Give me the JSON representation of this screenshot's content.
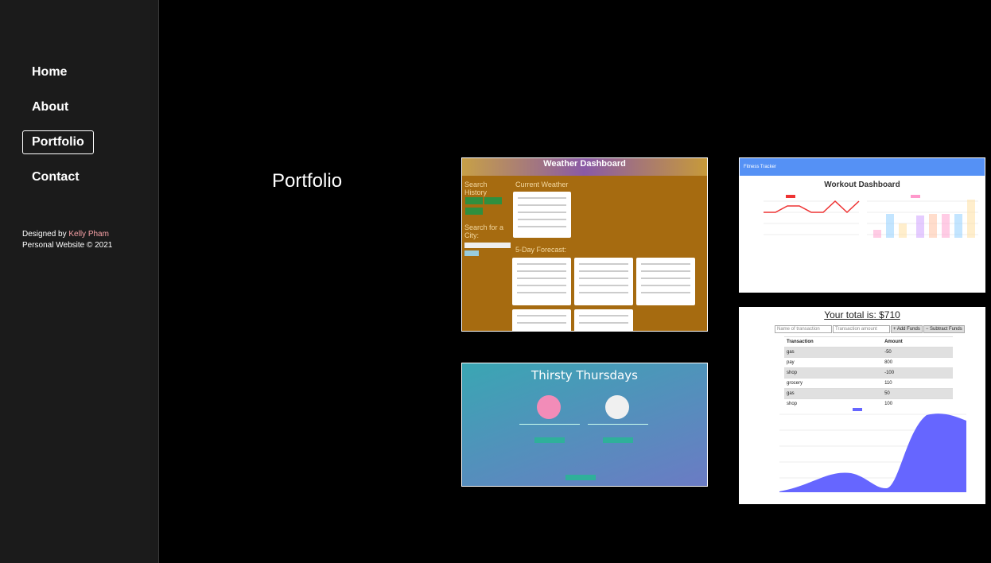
{
  "nav": {
    "items": [
      "Home",
      "About",
      "Portfolio",
      "Contact"
    ],
    "active": "Portfolio"
  },
  "credits": {
    "designed_by": "Designed by",
    "name": "Kelly Pham",
    "line2": "Personal Website © 2021"
  },
  "page_title": "Portfolio",
  "projects": {
    "weather": {
      "title": "Weather Dashboard",
      "search_history": "Search History",
      "search_city": "Search for a City:",
      "current": "Current Weather",
      "forecast": "5-Day Forecast:"
    },
    "workout": {
      "app": "Fitness Tracker",
      "title": "Workout Dashboard"
    },
    "thirsty": {
      "title": "Thirsty Thursdays"
    },
    "budget": {
      "total": "Your total is: $710",
      "name_placeholder": "Name of transaction",
      "amount_placeholder": "Transaction amount",
      "add": "+ Add Funds",
      "subtract": "− Subtract Funds",
      "headers": [
        "Transaction",
        "Amount"
      ],
      "rows": [
        [
          "gas",
          "-50"
        ],
        [
          "pay",
          "800"
        ],
        [
          "shop",
          "-100"
        ],
        [
          "grocery",
          "110"
        ],
        [
          "gas",
          "50"
        ],
        [
          "shop",
          "100"
        ]
      ]
    }
  },
  "colors": {
    "sidebar_bg": "#1b1b1b",
    "credit_name": "#f7a1a6",
    "weather_bg": "#a66b10",
    "chart_fill": "#6666ff"
  }
}
